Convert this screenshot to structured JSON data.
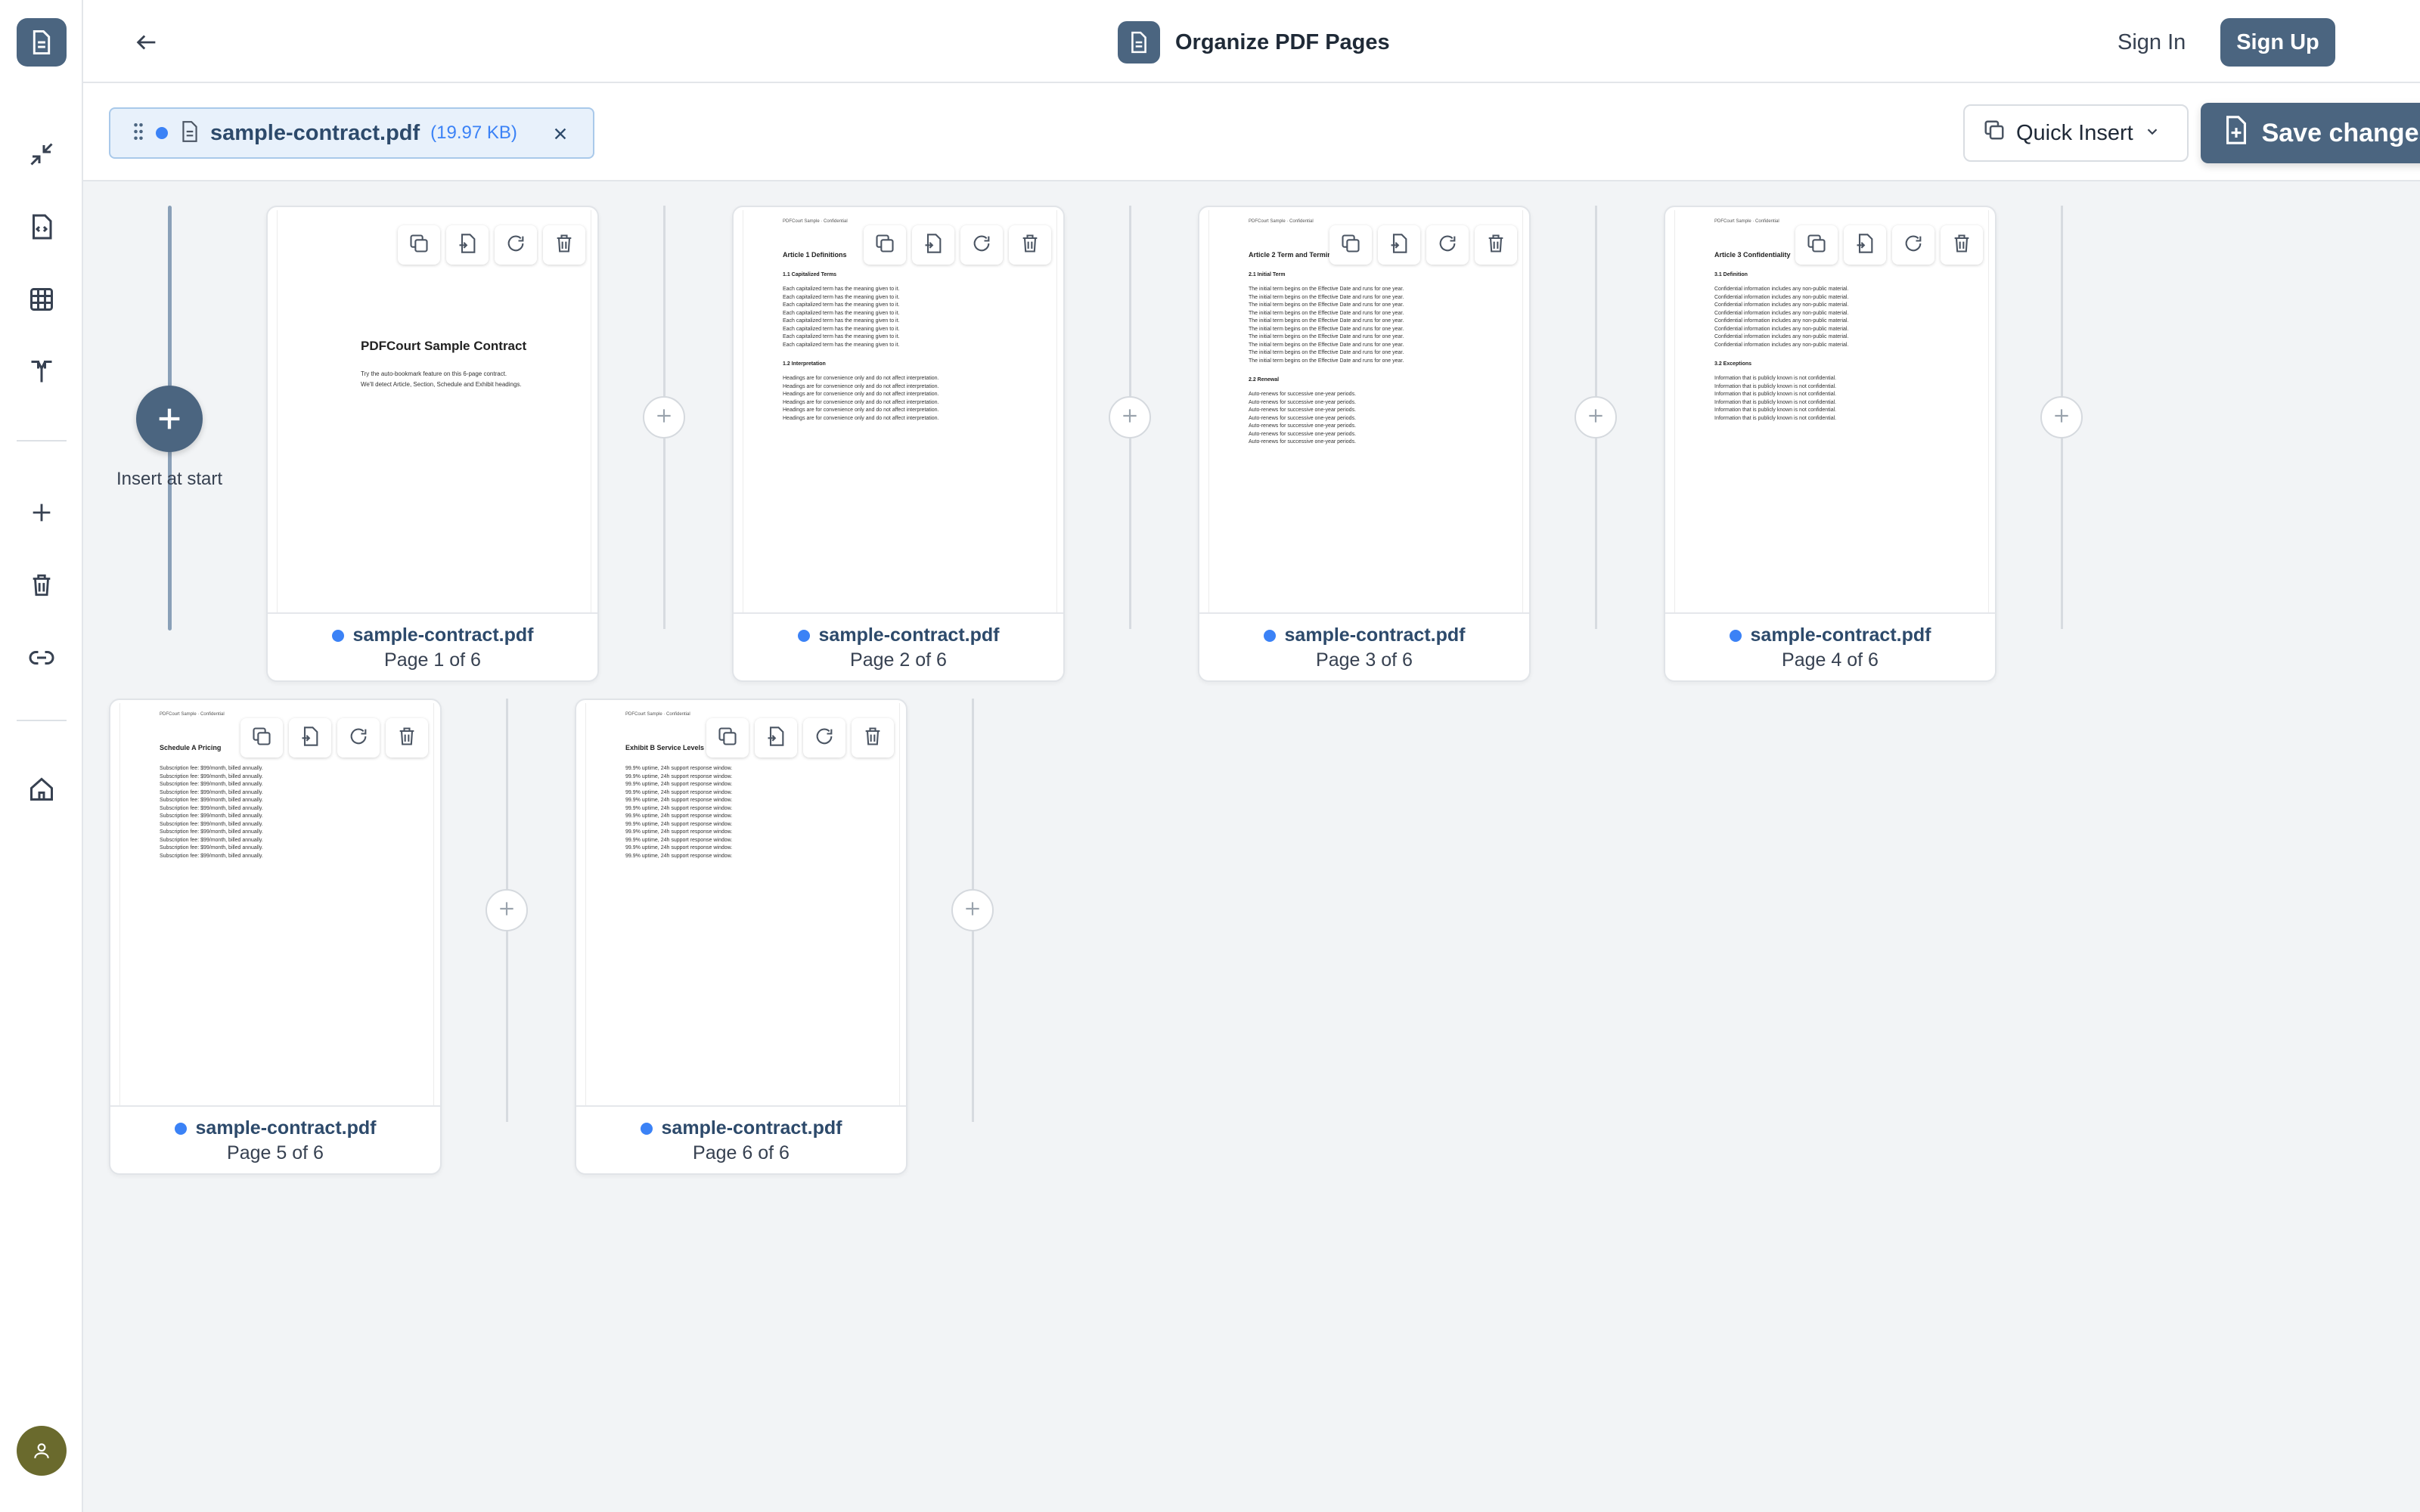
{
  "header": {
    "title": "Organize PDF Pages",
    "sign_in": "Sign In",
    "sign_up": "Sign Up"
  },
  "rail": {
    "icons": [
      "logo-icon",
      "compress-icon",
      "code-file-icon",
      "grid-icon",
      "split-icon",
      "add-icon",
      "trash-icon",
      "link-icon",
      "home-icon",
      "user-icon"
    ]
  },
  "file_chip": {
    "name": "sample-contract.pdf",
    "size": "(19.97 KB)"
  },
  "toolbar": {
    "quick_insert": "Quick Insert",
    "save": "Save changes"
  },
  "insert_start": "Insert at start",
  "pages": [
    {
      "file": "sample-contract.pdf",
      "label": "Page 1 of 6",
      "header": "",
      "title": "PDFCourt Sample Contract",
      "lines": [
        "Try the auto-bookmark feature on this 6-page contract.",
        "We'll detect Article, Section, Schedule and Exhibit headings."
      ]
    },
    {
      "file": "sample-contract.pdf",
      "label": "Page 2 of 6",
      "header": "PDFCourt Sample · Confidential",
      "title": "Article 1  Definitions",
      "sections": [
        {
          "heading": "1.1  Capitalized Terms",
          "line": "Each capitalized term has the meaning given to it.",
          "count": 8
        },
        {
          "heading": "1.2  Interpretation",
          "line": "Headings are for convenience only and do not affect interpretation.",
          "count": 6
        }
      ]
    },
    {
      "file": "sample-contract.pdf",
      "label": "Page 3 of 6",
      "header": "PDFCourt Sample · Confidential",
      "title": "Article 2  Term and Termination",
      "sections": [
        {
          "heading": "2.1  Initial Term",
          "line": "The initial term begins on the Effective Date and runs for one year.",
          "count": 10
        },
        {
          "heading": "2.2  Renewal",
          "line": "Auto-renews for successive one-year periods.",
          "count": 7
        }
      ]
    },
    {
      "file": "sample-contract.pdf",
      "label": "Page 4 of 6",
      "header": "PDFCourt Sample · Confidential",
      "title": "Article 3  Confidentiality",
      "sections": [
        {
          "heading": "3.1  Definition",
          "line": "Confidential information includes any non-public material.",
          "count": 8
        },
        {
          "heading": "3.2  Exceptions",
          "line": "Information that is publicly known is not confidential.",
          "count": 6
        }
      ]
    },
    {
      "file": "sample-contract.pdf",
      "label": "Page 5 of 6",
      "header": "PDFCourt Sample · Confidential",
      "title": "Schedule A  Pricing",
      "sections": [
        {
          "heading": "",
          "line": "Subscription fee: $99/month, billed annually.",
          "count": 12
        }
      ]
    },
    {
      "file": "sample-contract.pdf",
      "label": "Page 6 of 6",
      "header": "PDFCourt Sample · Confidential",
      "title": "Exhibit B  Service Levels",
      "sections": [
        {
          "heading": "",
          "line": "99.9% uptime, 24h support response window.",
          "count": 12
        }
      ]
    }
  ]
}
